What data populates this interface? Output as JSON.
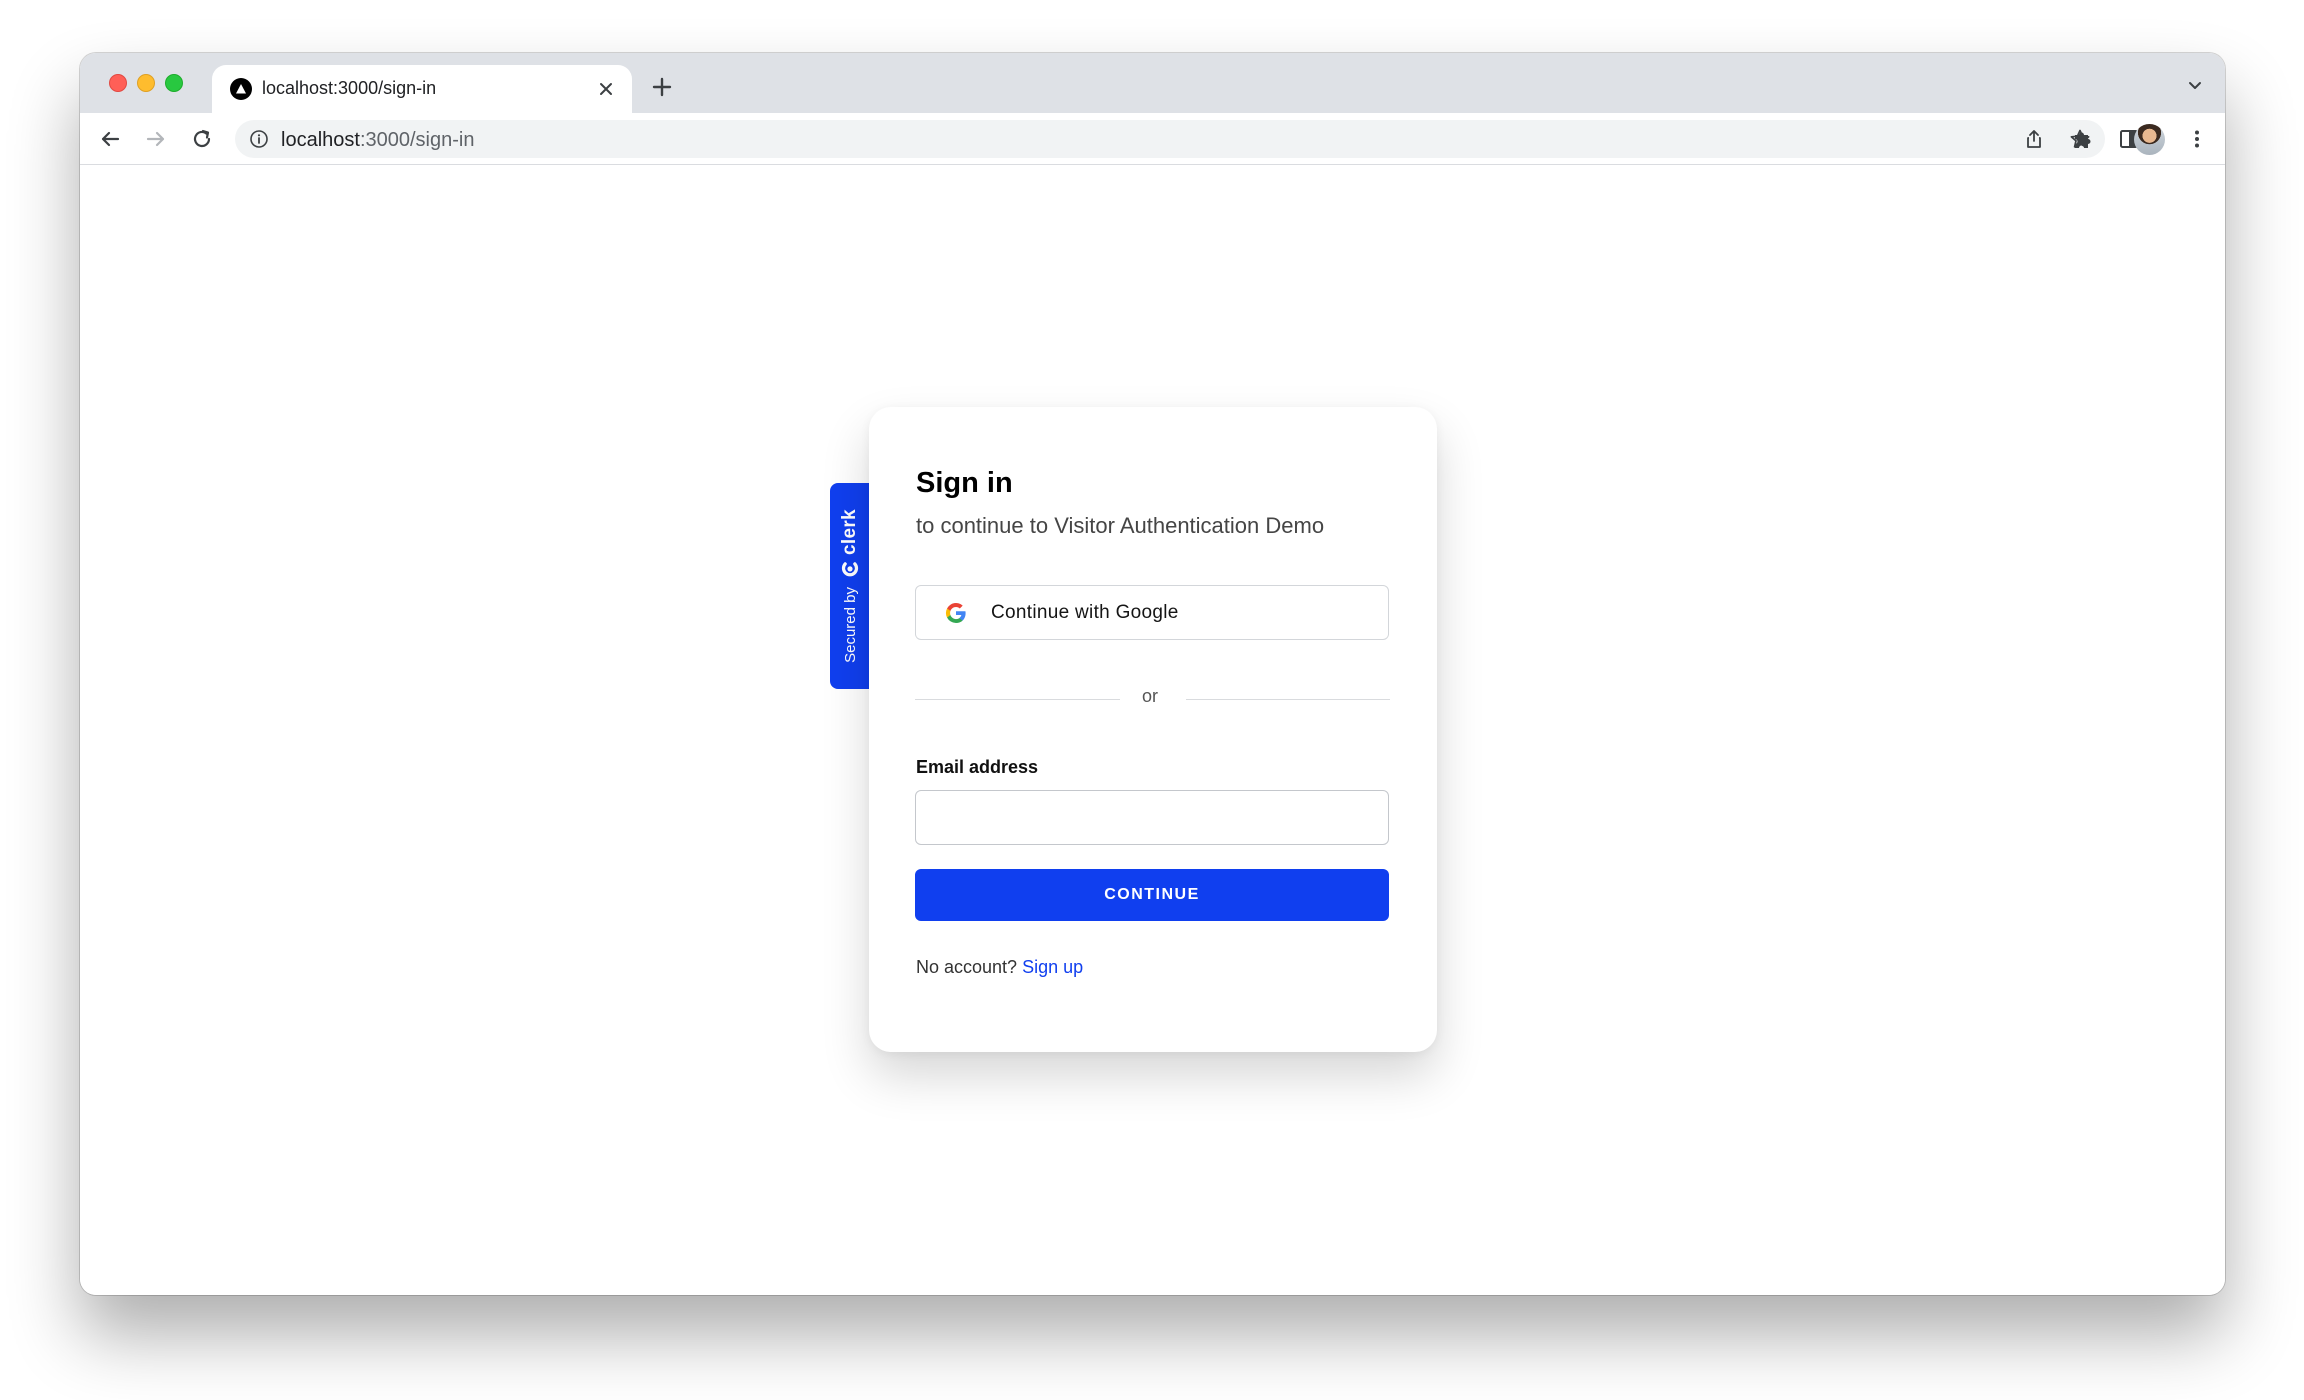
{
  "browser": {
    "tab_title": "localhost:3000/sign-in",
    "url_host": "localhost",
    "url_path": ":3000/sign-in"
  },
  "badge": {
    "secured_by": "Secured by",
    "brand": "clerk"
  },
  "sign_in": {
    "title": "Sign in",
    "subtitle": "to continue to Visitor Authentication Demo",
    "google_button": "Continue with Google",
    "divider": "or",
    "email_label": "Email address",
    "email_value": "",
    "continue_button": "CONTINUE",
    "no_account_text": "No account?",
    "sign_up_link": "Sign up"
  },
  "colors": {
    "primary": "#103fef",
    "traffic_red": "#ff5f57",
    "traffic_yellow": "#febc2e",
    "traffic_green": "#28c840"
  },
  "icons": {
    "favicon": "triangle-logo-icon",
    "tab_close": "close-icon",
    "new_tab": "plus-icon",
    "back": "arrow-left-icon",
    "forward": "arrow-right-icon",
    "reload": "reload-icon",
    "site_info": "info-icon",
    "share": "share-icon",
    "bookmark": "star-icon",
    "extensions": "puzzle-icon",
    "side_panel": "side-panel-icon",
    "menu": "more-vertical-icon",
    "google": "google-icon",
    "clerk_logo": "clerk-logo-icon"
  }
}
